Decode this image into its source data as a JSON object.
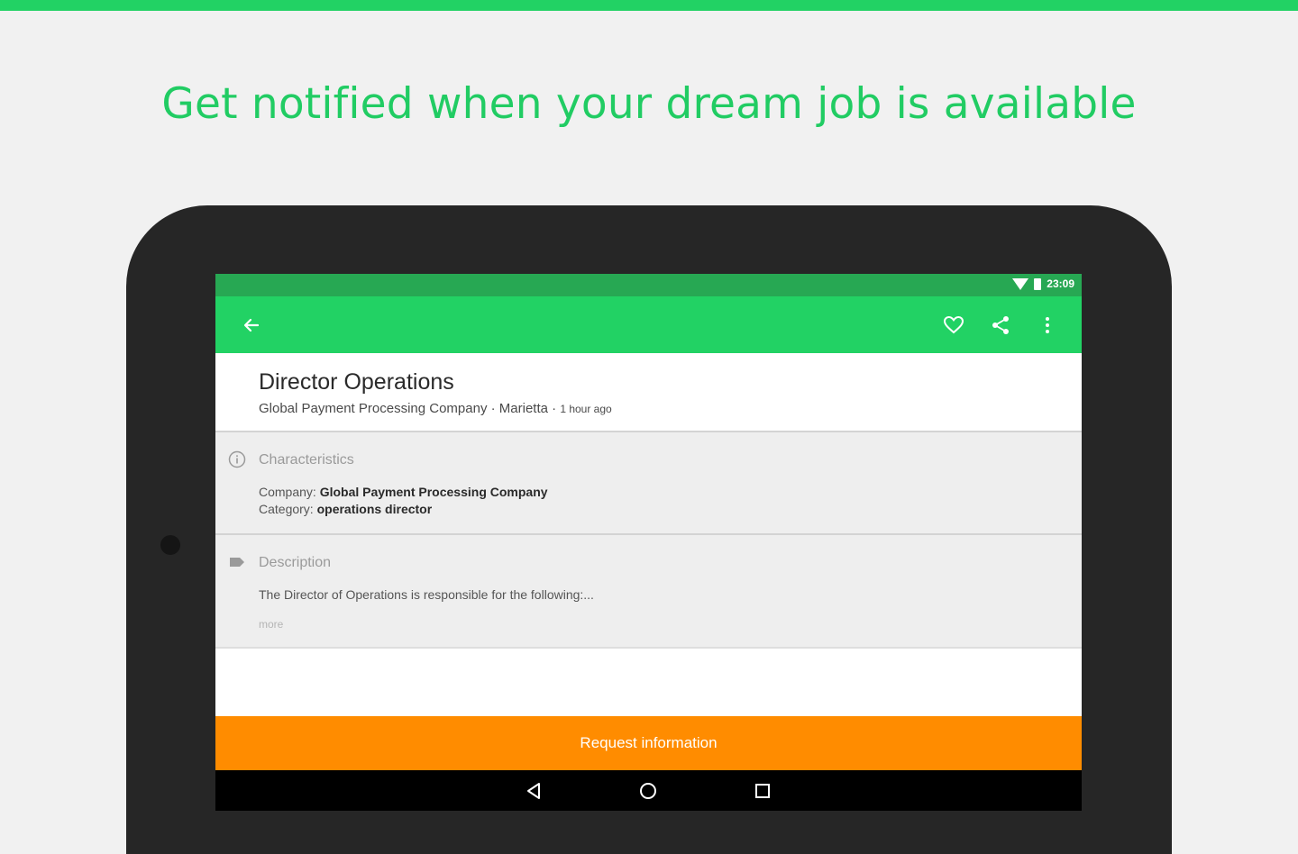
{
  "promo": {
    "headline": "Get notified when your dream job is available"
  },
  "statusbar": {
    "time": "23:09",
    "icons": [
      "wifi-icon",
      "battery-icon"
    ]
  },
  "appbar": {
    "icons": [
      "back-arrow-icon",
      "heart-icon",
      "share-icon",
      "more-vert-icon"
    ]
  },
  "job": {
    "title": "Director Operations",
    "company_location": "Global Payment Processing Company · Marietta · ",
    "posted": "1 hour ago"
  },
  "characteristics": {
    "title": "Characteristics",
    "company_label": "Company: ",
    "company_value": "Global Payment Processing Company",
    "category_label": "Category: ",
    "category_value": "operations director"
  },
  "description": {
    "title": "Description",
    "text": "The Director of Operations is responsible for the following:...",
    "more_label": "more"
  },
  "cta": {
    "label": "Request information"
  },
  "colors": {
    "brand_green": "#22d264",
    "status_green": "#27a853",
    "cta_orange": "#ff8c00",
    "headline_green": "#21cc63"
  }
}
